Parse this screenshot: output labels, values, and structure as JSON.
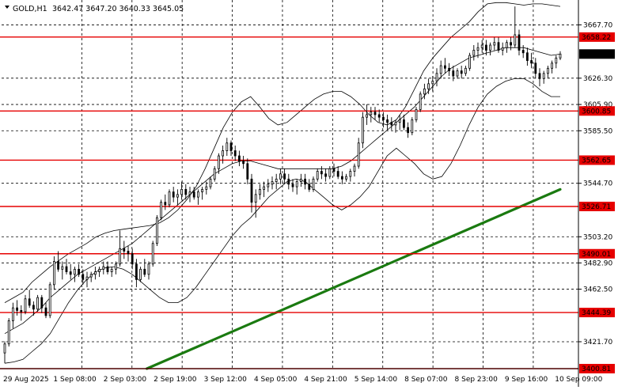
{
  "header": {
    "symbol": "GOLD,H1",
    "ohlc": "3642.47 3647.20 3640.33 3645.05"
  },
  "colors": {
    "background": "#ffffff",
    "candle": "#000000",
    "level_line": "#e60000",
    "level_label_bg": "#e60000",
    "bands": "#000000",
    "ma_line": "#1a7a10",
    "grid": "#000000",
    "price_label_bg": "#000000"
  },
  "chart_data": {
    "type": "candlestick",
    "title": "GOLD,H1",
    "symbol": "GOLD",
    "timeframe": "H1",
    "grid": true,
    "last_ohlc": {
      "open": 3642.47,
      "high": 3647.2,
      "low": 3640.33,
      "close": 3645.05
    },
    "current_price": 3645.05,
    "ylim": [
      3400.81,
      3687.0
    ],
    "y_ticks": [
      3667.7,
      3626.3,
      3605.9,
      3585.5,
      3544.7,
      3503.2,
      3482.9,
      3462.5,
      3421.7
    ],
    "x_ticks": [
      "29 Aug 2025",
      "1 Sep 08:00",
      "2 Sep 03:00",
      "2 Sep 19:00",
      "3 Sep 12:00",
      "4 Sep 05:00",
      "4 Sep 21:00",
      "5 Sep 14:00",
      "8 Sep 07:00",
      "8 Sep 23:00",
      "9 Sep 16:00",
      "10 Sep 09:00"
    ],
    "levels": [
      3658.22,
      3600.85,
      3562.65,
      3526.71,
      3490.01,
      3444.39,
      3400.81
    ],
    "candles": [
      [
        3413,
        3422,
        3405,
        3420
      ],
      [
        3420,
        3440,
        3418,
        3438
      ],
      [
        3438,
        3452,
        3432,
        3448
      ],
      [
        3448,
        3454,
        3442,
        3446
      ],
      [
        3446,
        3450,
        3438,
        3445
      ],
      [
        3445,
        3458,
        3443,
        3455
      ],
      [
        3455,
        3462,
        3448,
        3450
      ],
      [
        3450,
        3453,
        3442,
        3447
      ],
      [
        3447,
        3458,
        3445,
        3456
      ],
      [
        3456,
        3458,
        3444,
        3448
      ],
      [
        3448,
        3452,
        3440,
        3442
      ],
      [
        3442,
        3468,
        3440,
        3466
      ],
      [
        3466,
        3488,
        3462,
        3484
      ],
      [
        3484,
        3492,
        3476,
        3478
      ],
      [
        3478,
        3484,
        3470,
        3480
      ],
      [
        3480,
        3486,
        3474,
        3476
      ],
      [
        3476,
        3482,
        3470,
        3474
      ],
      [
        3474,
        3480,
        3468,
        3478
      ],
      [
        3478,
        3482,
        3472,
        3474
      ],
      [
        3474,
        3478,
        3466,
        3470
      ],
      [
        3470,
        3476,
        3464,
        3472
      ],
      [
        3472,
        3476,
        3468,
        3474
      ],
      [
        3474,
        3480,
        3470,
        3476
      ],
      [
        3476,
        3480,
        3472,
        3478
      ],
      [
        3478,
        3484,
        3474,
        3480
      ],
      [
        3480,
        3484,
        3474,
        3476
      ],
      [
        3476,
        3480,
        3472,
        3478
      ],
      [
        3478,
        3484,
        3474,
        3482
      ],
      [
        3482,
        3508,
        3480,
        3494
      ],
      [
        3494,
        3500,
        3486,
        3492
      ],
      [
        3492,
        3496,
        3484,
        3490
      ],
      [
        3490,
        3494,
        3478,
        3482
      ],
      [
        3482,
        3486,
        3464,
        3470
      ],
      [
        3470,
        3480,
        3468,
        3478
      ],
      [
        3478,
        3486,
        3472,
        3474
      ],
      [
        3474,
        3484,
        3470,
        3482
      ],
      [
        3482,
        3500,
        3480,
        3498
      ],
      [
        3498,
        3520,
        3496,
        3518
      ],
      [
        3518,
        3532,
        3516,
        3530
      ],
      [
        3530,
        3536,
        3524,
        3528
      ],
      [
        3528,
        3540,
        3526,
        3538
      ],
      [
        3538,
        3542,
        3530,
        3534
      ],
      [
        3534,
        3540,
        3528,
        3536
      ],
      [
        3536,
        3546,
        3532,
        3540
      ],
      [
        3540,
        3544,
        3532,
        3536
      ],
      [
        3536,
        3542,
        3530,
        3538
      ],
      [
        3538,
        3542,
        3532,
        3534
      ],
      [
        3534,
        3540,
        3528,
        3538
      ],
      [
        3538,
        3542,
        3532,
        3540
      ],
      [
        3540,
        3546,
        3536,
        3542
      ],
      [
        3542,
        3550,
        3540,
        3548
      ],
      [
        3548,
        3558,
        3546,
        3556
      ],
      [
        3556,
        3568,
        3552,
        3566
      ],
      [
        3566,
        3574,
        3560,
        3570
      ],
      [
        3570,
        3580,
        3566,
        3576
      ],
      [
        3576,
        3578,
        3566,
        3570
      ],
      [
        3570,
        3574,
        3562,
        3566
      ],
      [
        3566,
        3570,
        3558,
        3562
      ],
      [
        3562,
        3566,
        3556,
        3560
      ],
      [
        3560,
        3564,
        3544,
        3548
      ],
      [
        3548,
        3552,
        3522,
        3530
      ],
      [
        3530,
        3540,
        3518,
        3536
      ],
      [
        3536,
        3544,
        3532,
        3540
      ],
      [
        3540,
        3546,
        3534,
        3542
      ],
      [
        3542,
        3548,
        3538,
        3544
      ],
      [
        3544,
        3550,
        3540,
        3546
      ],
      [
        3546,
        3552,
        3540,
        3548
      ],
      [
        3548,
        3556,
        3544,
        3552
      ],
      [
        3552,
        3556,
        3544,
        3548
      ],
      [
        3548,
        3552,
        3540,
        3544
      ],
      [
        3544,
        3548,
        3538,
        3542
      ],
      [
        3542,
        3548,
        3536,
        3546
      ],
      [
        3546,
        3552,
        3542,
        3548
      ],
      [
        3548,
        3552,
        3540,
        3544
      ],
      [
        3544,
        3548,
        3538,
        3540
      ],
      [
        3540,
        3550,
        3538,
        3548
      ],
      [
        3548,
        3556,
        3546,
        3554
      ],
      [
        3554,
        3558,
        3548,
        3552
      ],
      [
        3552,
        3556,
        3546,
        3550
      ],
      [
        3550,
        3558,
        3548,
        3556
      ],
      [
        3556,
        3560,
        3550,
        3554
      ],
      [
        3554,
        3558,
        3548,
        3550
      ],
      [
        3550,
        3554,
        3544,
        3548
      ],
      [
        3548,
        3552,
        3546,
        3550
      ],
      [
        3550,
        3556,
        3546,
        3554
      ],
      [
        3554,
        3560,
        3550,
        3558
      ],
      [
        3558,
        3580,
        3556,
        3576
      ],
      [
        3576,
        3600,
        3572,
        3596
      ],
      [
        3596,
        3606,
        3590,
        3598
      ],
      [
        3598,
        3604,
        3592,
        3600
      ],
      [
        3600,
        3604,
        3594,
        3598
      ],
      [
        3598,
        3602,
        3592,
        3596
      ],
      [
        3596,
        3600,
        3588,
        3594
      ],
      [
        3594,
        3598,
        3586,
        3592
      ],
      [
        3592,
        3596,
        3586,
        3590
      ],
      [
        3590,
        3594,
        3584,
        3592
      ],
      [
        3592,
        3598,
        3586,
        3594
      ],
      [
        3594,
        3598,
        3586,
        3588
      ],
      [
        3588,
        3592,
        3580,
        3584
      ],
      [
        3584,
        3596,
        3582,
        3594
      ],
      [
        3594,
        3604,
        3592,
        3602
      ],
      [
        3602,
        3616,
        3600,
        3614
      ],
      [
        3614,
        3622,
        3610,
        3618
      ],
      [
        3618,
        3626,
        3614,
        3622
      ],
      [
        3622,
        3628,
        3616,
        3624
      ],
      [
        3624,
        3634,
        3620,
        3630
      ],
      [
        3630,
        3640,
        3626,
        3636
      ],
      [
        3636,
        3642,
        3630,
        3634
      ],
      [
        3634,
        3638,
        3628,
        3632
      ],
      [
        3632,
        3636,
        3624,
        3628
      ],
      [
        3628,
        3634,
        3626,
        3632
      ],
      [
        3632,
        3636,
        3626,
        3630
      ],
      [
        3630,
        3636,
        3628,
        3634
      ],
      [
        3634,
        3646,
        3632,
        3644
      ],
      [
        3644,
        3652,
        3640,
        3648
      ],
      [
        3648,
        3654,
        3642,
        3650
      ],
      [
        3650,
        3656,
        3646,
        3652
      ],
      [
        3652,
        3656,
        3644,
        3648
      ],
      [
        3648,
        3654,
        3644,
        3652
      ],
      [
        3652,
        3658,
        3648,
        3654
      ],
      [
        3654,
        3658,
        3646,
        3648
      ],
      [
        3648,
        3654,
        3644,
        3650
      ],
      [
        3650,
        3656,
        3646,
        3654
      ],
      [
        3654,
        3658,
        3648,
        3652
      ],
      [
        3652,
        3682,
        3650,
        3660
      ],
      [
        3660,
        3664,
        3644,
        3648
      ],
      [
        3648,
        3652,
        3642,
        3646
      ],
      [
        3646,
        3650,
        3636,
        3640
      ],
      [
        3640,
        3646,
        3634,
        3638
      ],
      [
        3638,
        3642,
        3626,
        3630
      ],
      [
        3630,
        3634,
        3620,
        3626
      ],
      [
        3626,
        3632,
        3622,
        3630
      ],
      [
        3630,
        3636,
        3626,
        3634
      ],
      [
        3634,
        3640,
        3630,
        3638
      ],
      [
        3638,
        3644,
        3634,
        3642
      ],
      [
        3642,
        3647.2,
        3640.33,
        3645.05
      ]
    ],
    "upper_band": [
      3452,
      3456,
      3460,
      3468,
      3474,
      3480,
      3485,
      3490,
      3494,
      3498,
      3503,
      3506,
      3508,
      3509,
      3510,
      3511,
      3512,
      3514,
      3518,
      3524,
      3532,
      3542,
      3556,
      3572,
      3588,
      3600,
      3608,
      3612,
      3604,
      3595,
      3590,
      3592,
      3598,
      3604,
      3610,
      3614,
      3616,
      3616,
      3612,
      3606,
      3598,
      3592,
      3590,
      3594,
      3604,
      3618,
      3632,
      3642,
      3650,
      3658,
      3664,
      3670,
      3678,
      3684,
      3685,
      3685,
      3684,
      3683,
      3684,
      3684,
      3683,
      3682
    ],
    "lower_band": [
      3405,
      3406,
      3408,
      3414,
      3420,
      3428,
      3440,
      3452,
      3462,
      3470,
      3476,
      3479,
      3480,
      3478,
      3474,
      3468,
      3462,
      3456,
      3452,
      3452,
      3456,
      3464,
      3474,
      3484,
      3494,
      3504,
      3512,
      3518,
      3526,
      3534,
      3540,
      3546,
      3548,
      3546,
      3540,
      3534,
      3528,
      3524,
      3528,
      3534,
      3542,
      3554,
      3566,
      3572,
      3566,
      3560,
      3552,
      3548,
      3550,
      3560,
      3574,
      3590,
      3604,
      3614,
      3620,
      3624,
      3626,
      3626,
      3622,
      3616,
      3612,
      3612
    ],
    "middle_band": [
      3428,
      3432,
      3436,
      3442,
      3448,
      3456,
      3462,
      3468,
      3474,
      3478,
      3482,
      3486,
      3490,
      3494,
      3498,
      3504,
      3510,
      3516,
      3522,
      3528,
      3534,
      3540,
      3546,
      3552,
      3556,
      3560,
      3562,
      3562,
      3560,
      3558,
      3556,
      3556,
      3556,
      3556,
      3556,
      3556,
      3556,
      3558,
      3562,
      3568,
      3574,
      3580,
      3586,
      3592,
      3598,
      3604,
      3612,
      3620,
      3628,
      3634,
      3638,
      3642,
      3644,
      3646,
      3648,
      3650,
      3650,
      3650,
      3648,
      3646,
      3644,
      3645
    ],
    "ma_line": {
      "x_start": 0.26,
      "y_start": 3400.81,
      "x_end": 1.0,
      "y_end": 3540.0
    }
  }
}
